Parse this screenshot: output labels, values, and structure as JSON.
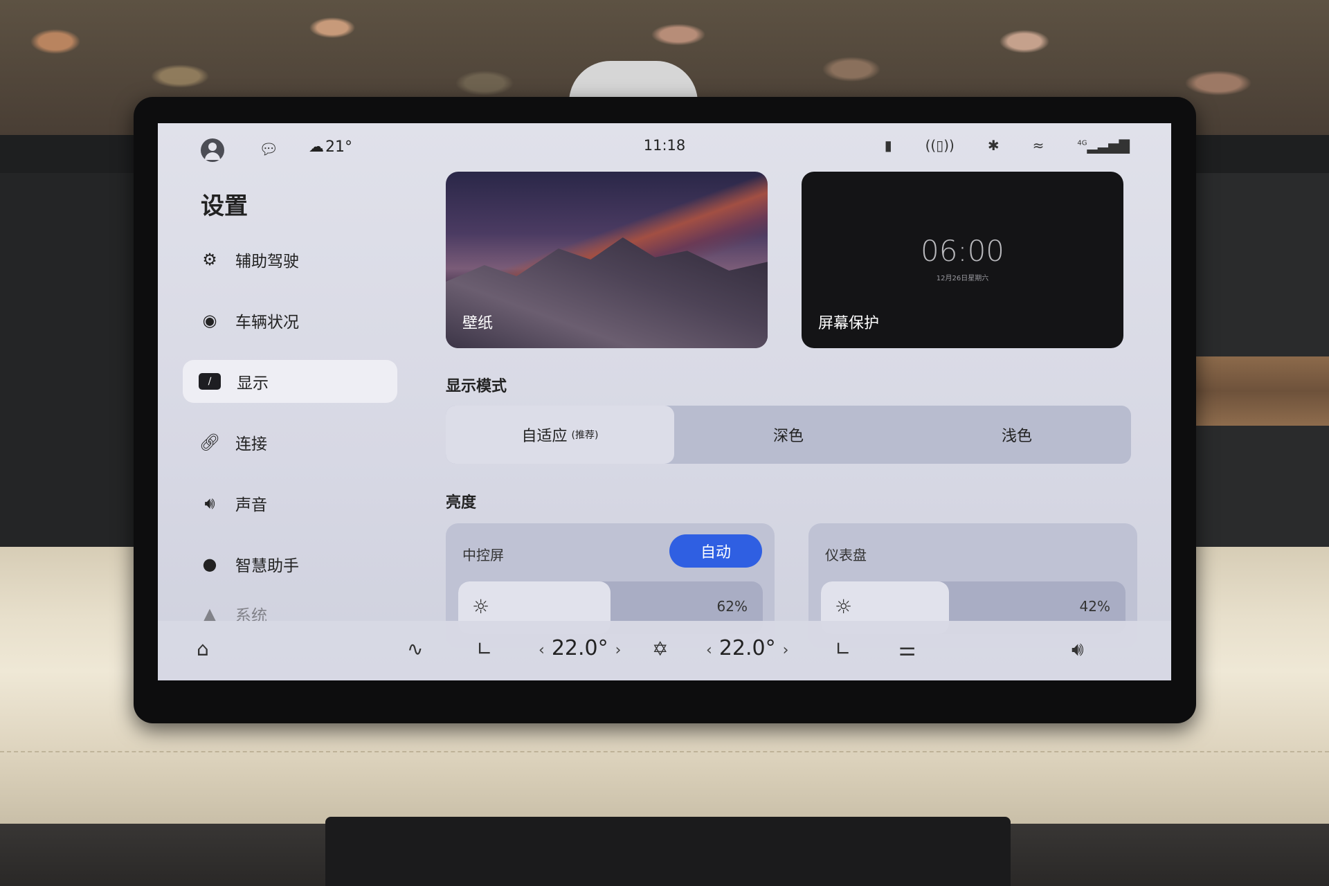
{
  "status_bar": {
    "weather_temp": "21°",
    "time": "11:18",
    "network_label": "4G"
  },
  "sidebar": {
    "title": "设置",
    "items": [
      {
        "label": "辅助驾驶",
        "icon": "steering-wheel-icon",
        "active": false
      },
      {
        "label": "车辆状况",
        "icon": "vehicle-status-icon",
        "active": false
      },
      {
        "label": "显示",
        "icon": "display-icon",
        "active": true
      },
      {
        "label": "连接",
        "icon": "link-icon",
        "active": false
      },
      {
        "label": "声音",
        "icon": "speaker-icon",
        "active": false
      },
      {
        "label": "智慧助手",
        "icon": "assistant-icon",
        "active": false
      },
      {
        "label": "系统",
        "icon": "system-icon",
        "active": false
      }
    ]
  },
  "cards": {
    "wallpaper_label": "壁纸",
    "screensaver_label": "屏幕保护",
    "screensaver_time": "06:00",
    "screensaver_date": "12月26日星期六"
  },
  "display_mode": {
    "title": "显示模式",
    "options": [
      {
        "label": "自适应",
        "note": "(推荐)",
        "selected": true
      },
      {
        "label": "深色",
        "note": "",
        "selected": false
      },
      {
        "label": "浅色",
        "note": "",
        "selected": false
      }
    ]
  },
  "brightness": {
    "title": "亮度",
    "center_screen": {
      "label": "中控屏",
      "auto_label": "自动",
      "value_text": "62%",
      "level": 0.5
    },
    "instrument": {
      "label": "仪表盘",
      "value_text": "42%",
      "level": 0.42
    }
  },
  "dock": {
    "left_temp": "22.0°",
    "right_temp": "22.0°"
  },
  "colors": {
    "accent": "#2f5fe2",
    "screen_bg": "#d7d8e4"
  }
}
